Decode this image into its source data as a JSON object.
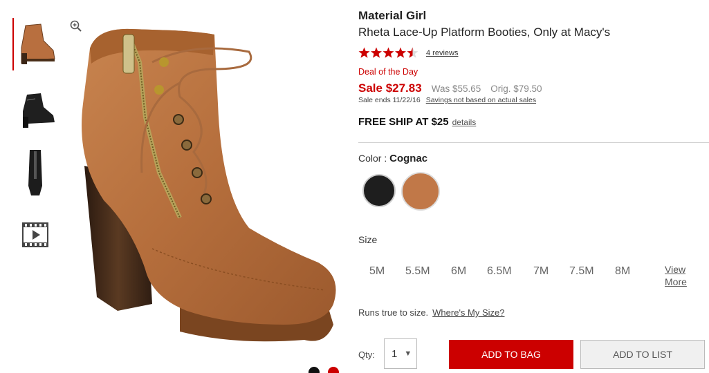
{
  "product": {
    "brand": "Material Girl",
    "name": "Rheta Lace-Up Platform Booties, Only at Macy's",
    "rating": 4.5,
    "rating_max": 5,
    "reviews": "4 reviews",
    "deal": "Deal of the Day",
    "sale_price": "Sale $27.83",
    "was_price": "Was $55.65",
    "orig_price": "Orig. $79.50",
    "sale_ends": "Sale ends 11/22/16",
    "savings_note": "Savings not based on actual sales",
    "free_ship": "FREE SHIP AT $25",
    "details": "details"
  },
  "color": {
    "label": "Color : ",
    "selected": "Cognac",
    "swatches": [
      "Black",
      "Cognac"
    ]
  },
  "size": {
    "label": "Size",
    "options": [
      "5M",
      "5.5M",
      "6M",
      "6.5M",
      "7M",
      "7.5M",
      "8M"
    ],
    "view_more_1": "View",
    "view_more_2": "More",
    "true_to_size": "Runs true to size.",
    "wheres_my_size": "Where's My Size?"
  },
  "purchase": {
    "qty_label": "Qty:",
    "qty_value": "1",
    "add_to_bag": "ADD TO BAG",
    "add_to_list": "ADD TO LIST"
  },
  "icons": {
    "zoom": "zoom-in-icon",
    "video": "video-icon",
    "qty_arrow": "▼"
  },
  "colors": {
    "accent": "#cc0000",
    "star": "#cc0000",
    "cognac": "#c17848"
  }
}
